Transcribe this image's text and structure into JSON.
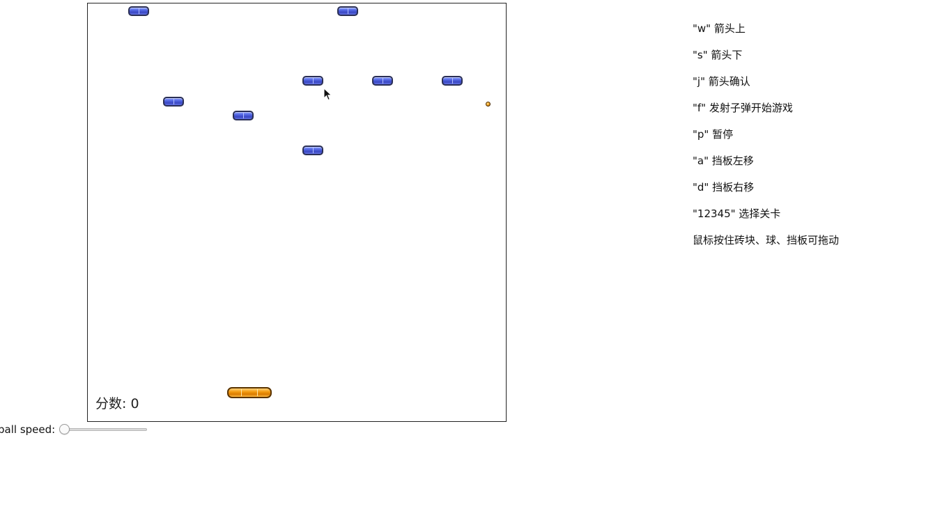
{
  "game": {
    "score_text": "分数: 0",
    "colors": {
      "brick": "#4f63e0",
      "paddle": "#f29a10",
      "ball": "#f0a020"
    },
    "cursor_icon": "mouse-pointer-icon"
  },
  "speed_control": {
    "label": "ball speed:",
    "value_fraction": 0
  },
  "help": {
    "items": [
      "\"w\" 箭头上",
      "\"s\" 箭头下",
      "\"j\" 箭头确认",
      "\"f\" 发射子弹开始游戏",
      "\"p\" 暂停",
      "\"a\" 挡板左移",
      "\"d\" 挡板右移",
      "\"12345\" 选择关卡",
      "鼠标按住砖块、球、挡板可拖动"
    ]
  }
}
